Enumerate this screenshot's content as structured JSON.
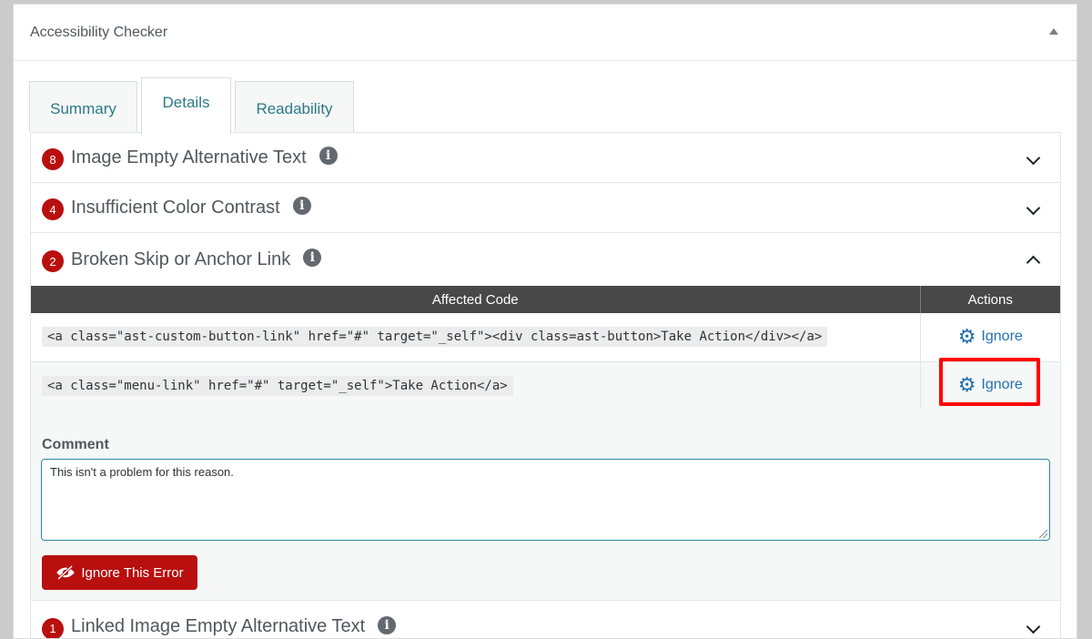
{
  "panel": {
    "title": "Accessibility Checker"
  },
  "tabs": [
    {
      "label": "Summary"
    },
    {
      "label": "Details"
    },
    {
      "label": "Readability"
    }
  ],
  "issues": [
    {
      "count": "8",
      "label": "Image Empty Alternative Text",
      "expanded": false
    },
    {
      "count": "4",
      "label": "Insufficient Color Contrast",
      "expanded": false
    },
    {
      "count": "2",
      "label": "Broken Skip or Anchor Link",
      "expanded": true
    },
    {
      "count": "1",
      "label": "Linked Image Empty Alternative Text",
      "expanded": false
    }
  ],
  "table": {
    "headers": {
      "code": "Affected Code",
      "actions": "Actions"
    },
    "rows": [
      {
        "code": "<a class=\"ast-custom-button-link\" href=\"#\" target=\"_self\"><div class=ast-button>Take Action</div></a>",
        "action": "Ignore"
      },
      {
        "code": "<a class=\"menu-link\" href=\"#\" target=\"_self\">Take Action</a>",
        "action": "Ignore"
      }
    ]
  },
  "comment": {
    "label": "Comment",
    "value": "This isn't a problem for this reason.",
    "button": "Ignore This Error"
  },
  "colors": {
    "badge": "#b90f0f",
    "link": "#2271b1",
    "highlight": "#ff0000",
    "header_bg": "#484848"
  }
}
